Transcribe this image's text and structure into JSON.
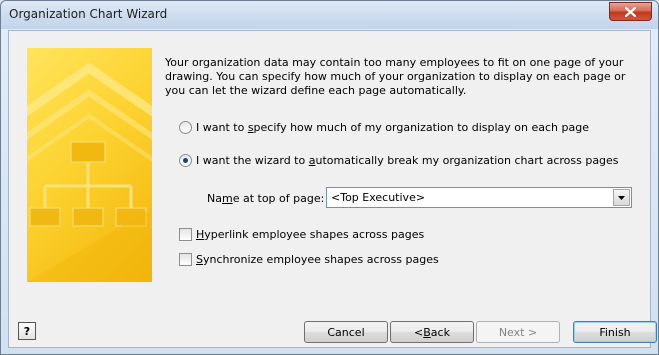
{
  "window": {
    "title": "Organization Chart Wizard"
  },
  "intro_text": "Your organization data may contain too many employees to fit on one page of your drawing.  You can specify how much of your organization to display on each page or you can let the wizard define each page automatically.",
  "options": {
    "specify": {
      "pre": "I want to ",
      "key": "s",
      "post": "pecify how much of my organization to display on each page",
      "selected": false
    },
    "auto": {
      "pre": "I want the wizard to ",
      "key": "a",
      "post": "utomatically break my organization chart across pages",
      "selected": true
    }
  },
  "name_field": {
    "label_pre": "Na",
    "label_key": "m",
    "label_post": "e at top of page:",
    "value": "<Top Executive>"
  },
  "checkboxes": {
    "hyperlink": {
      "key": "H",
      "post": "yperlink employee shapes across pages",
      "checked": false
    },
    "synchronize": {
      "key": "S",
      "post": "ynchronize employee shapes across pages",
      "checked": false
    }
  },
  "buttons": {
    "help": "?",
    "cancel": "Cancel",
    "back_pre": "< ",
    "back_key": "B",
    "back_post": "ack",
    "next": "Next >",
    "finish": "Finish"
  },
  "colors": {
    "banner_yellow": "#fcd22f",
    "close_red": "#c2381e",
    "radio_dot": "#1d3f7a"
  },
  "icons": {
    "close": "close-icon",
    "help": "help-icon",
    "dropdown": "chevron-down-icon",
    "banner": "org-chart-banner"
  }
}
